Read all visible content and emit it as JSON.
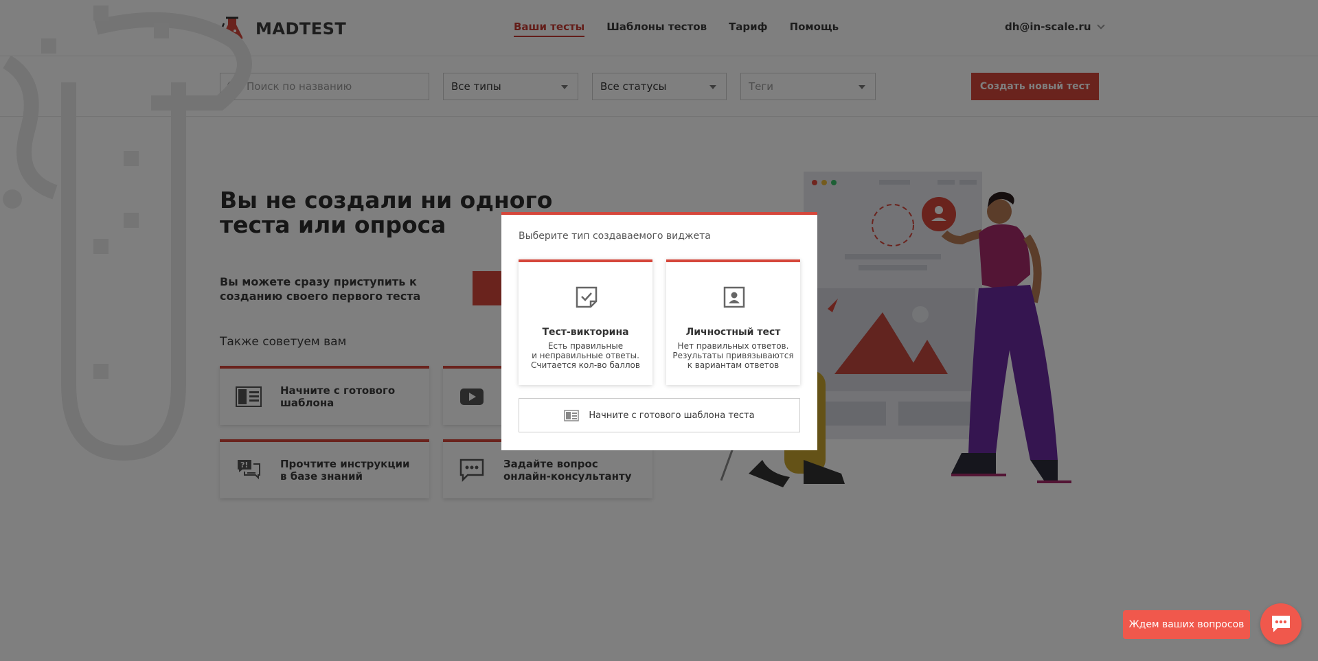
{
  "brand": {
    "name": "MADTEST"
  },
  "nav": {
    "items": [
      {
        "label": "Ваши тесты",
        "active": true
      },
      {
        "label": "Шаблоны тестов",
        "active": false
      },
      {
        "label": "Тариф",
        "active": false
      },
      {
        "label": "Помощь",
        "active": false
      }
    ]
  },
  "user": {
    "email": "dh@in-scale.ru"
  },
  "filters": {
    "search_placeholder": "Поиск по названию",
    "type_select": "Все типы",
    "status_select": "Все статусы",
    "tags_select": "Теги",
    "create_button": "Создать новый тест"
  },
  "empty_state": {
    "headline": "Вы не создали ни одного теста или опроса",
    "subtext": "Вы можете сразу приступить к созданию своего первого теста",
    "also_title": "Также советуем вам",
    "cards": [
      {
        "label": "Начните с готового\nшаблона",
        "icon": "template-icon"
      },
      {
        "label": "",
        "icon": "video-icon"
      },
      {
        "label": "Прочтите инструкции\nв базе знаний",
        "icon": "faq-icon"
      },
      {
        "label": "Задайте вопрос\nонлайн-консультанту",
        "icon": "chat-icon"
      }
    ]
  },
  "modal": {
    "title": "Выберите тип создаваемого виджета",
    "options": [
      {
        "title": "Тест-викторина",
        "description": "Есть правильные\nи неправильные ответы.\nСчитается кол-во баллов",
        "icon": "checked-note-icon"
      },
      {
        "title": "Личностный тест",
        "description": "Нет правильных ответов.\nРезультаты привязываются\nк вариантам ответов",
        "icon": "person-frame-icon"
      }
    ],
    "template_button": "Начните с готового шаблона теста"
  },
  "chat": {
    "label": "Ждем ваших вопросов"
  },
  "colors": {
    "accent": "#d5473b",
    "chat": "#f0584c"
  }
}
